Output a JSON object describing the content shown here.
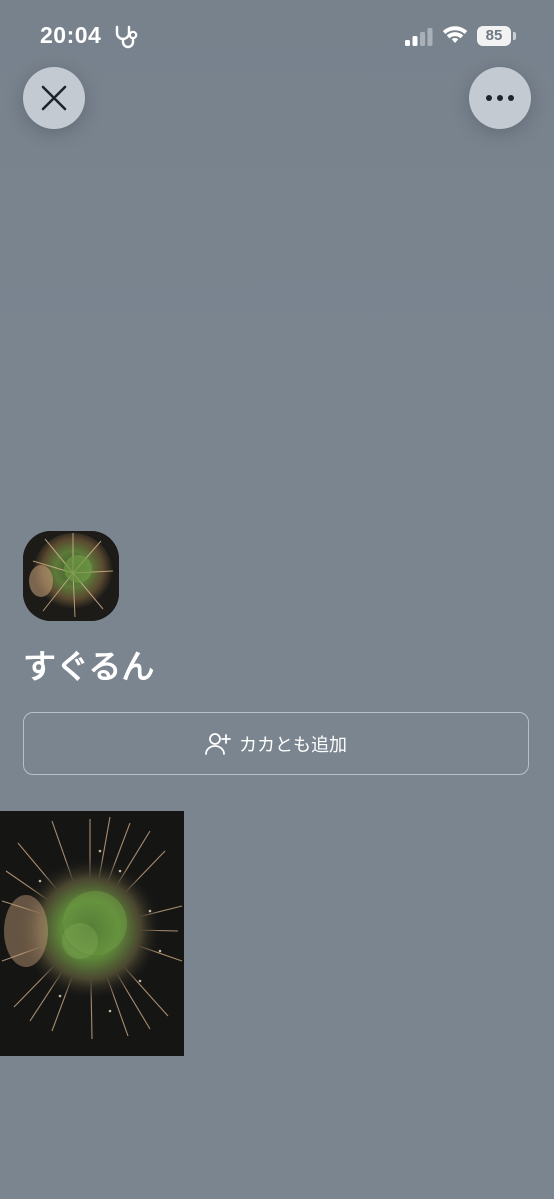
{
  "status_bar": {
    "time": "20:04",
    "battery_level": "85"
  },
  "top_bar": {
    "close_icon": "close-icon",
    "more_icon": "more-icon"
  },
  "profile": {
    "name": "すぐるん",
    "avatar_icon": "fireworks-photo"
  },
  "actions": {
    "add_friend_label": "カカとも追加",
    "add_friend_icon": "add-user-icon"
  },
  "gallery": {
    "items": [
      {
        "image": "fireworks-photo"
      }
    ]
  },
  "colors": {
    "background": "#7b8590",
    "button_fill": "#c3cad2",
    "text": "#ffffff"
  }
}
